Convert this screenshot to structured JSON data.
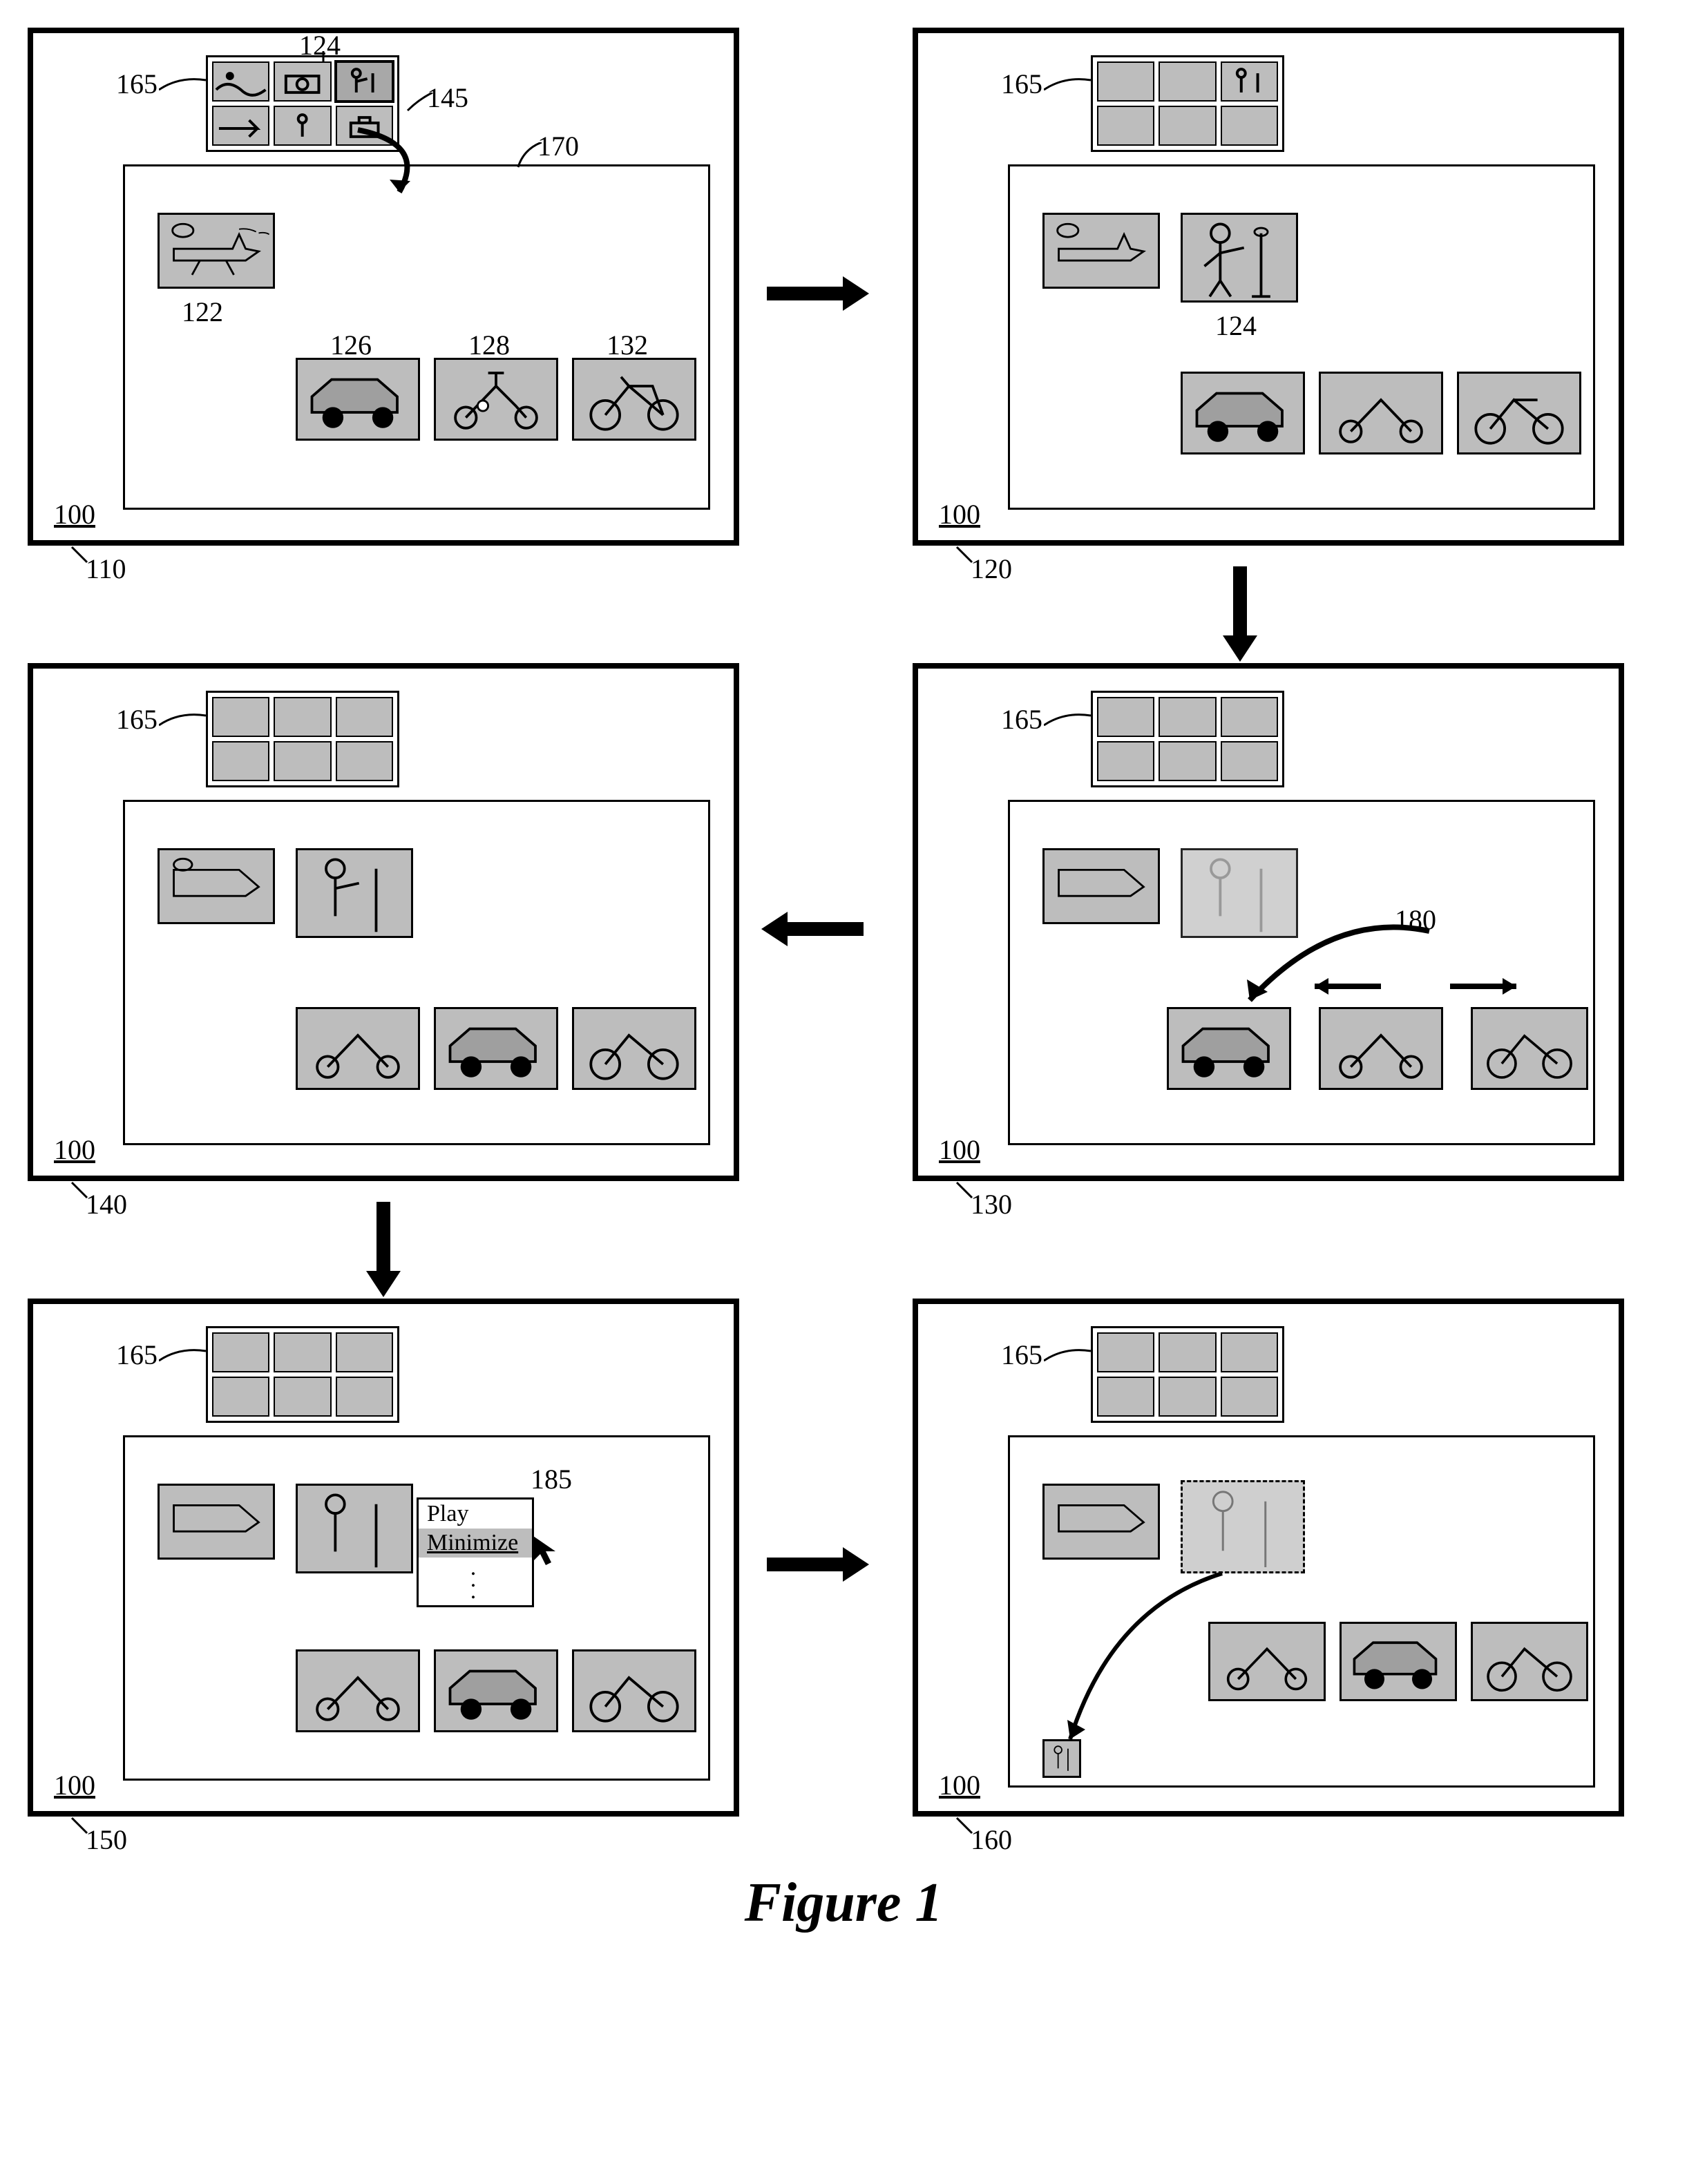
{
  "figure_caption": "Figure 1",
  "panel_code_label": "100",
  "panels": {
    "p110": "110",
    "p120": "120",
    "p130": "130",
    "p140": "140",
    "p150": "150",
    "p160": "160"
  },
  "refs": {
    "browser": "165",
    "comp_area": "170",
    "drag_arrow": "145",
    "clip_plane": "122",
    "clip_person_small": "124",
    "clip_person_placed": "124",
    "clip_car": "126",
    "clip_scooter": "128",
    "clip_bike": "132",
    "reorder_arrow": "180",
    "context_menu": "185"
  },
  "menu": {
    "play": "Play",
    "minimize": "Minimize",
    "more": "⋮"
  },
  "icons": {
    "plane": "plane-icon",
    "person": "person-mic-icon",
    "car": "car-icon",
    "scooter": "scooter-icon",
    "bike": "bike-icon",
    "swim": "swim-icon",
    "camera": "camera-icon",
    "briefcase": "briefcase-icon"
  }
}
